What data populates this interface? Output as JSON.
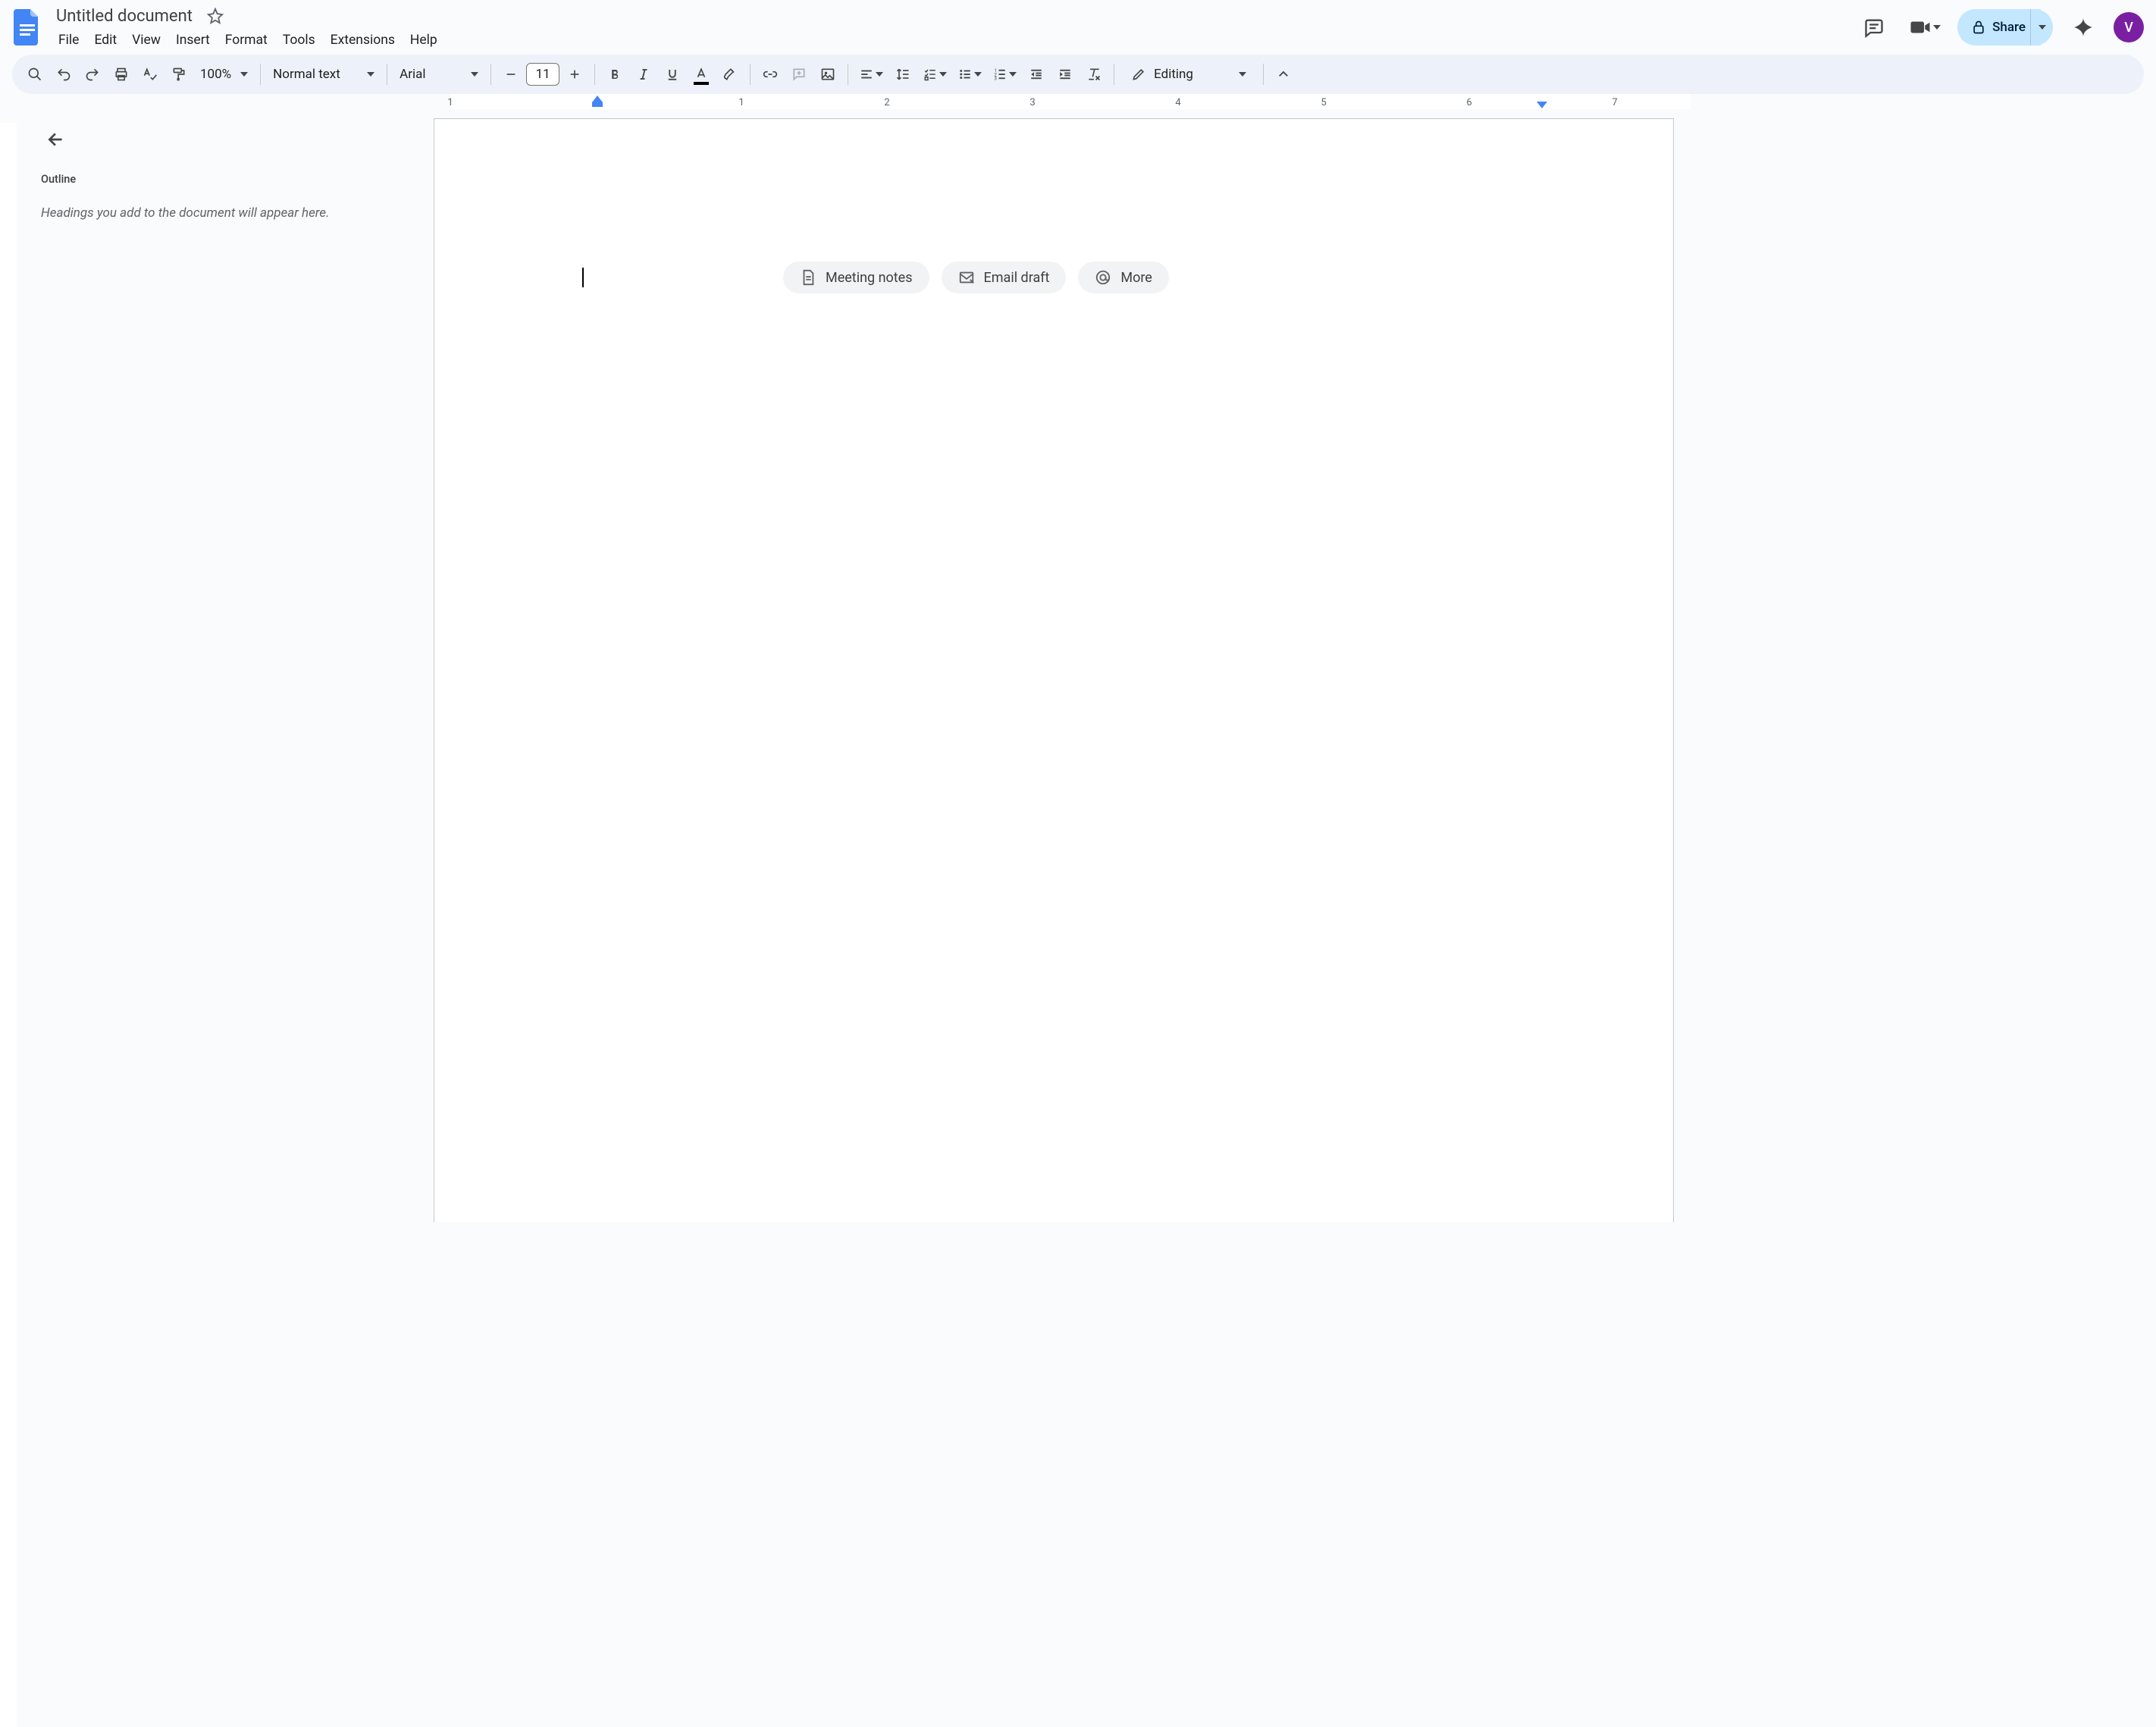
{
  "header": {
    "doc_title": "Untitled document",
    "menus": [
      "File",
      "Edit",
      "View",
      "Insert",
      "Format",
      "Tools",
      "Extensions",
      "Help"
    ],
    "share_label": "Share",
    "avatar_initial": "V"
  },
  "toolbar": {
    "zoom": "100%",
    "style": "Normal text",
    "font": "Arial",
    "font_size": "11",
    "mode": "Editing"
  },
  "ruler": {
    "numbers": [
      "1",
      "",
      "1",
      "2",
      "3",
      "4",
      "5",
      "6",
      "7"
    ]
  },
  "outline": {
    "title": "Outline",
    "empty_text": "Headings you add to the document will appear here."
  },
  "chips": {
    "meeting": "Meeting notes",
    "email": "Email draft",
    "more": "More"
  },
  "colors": {
    "share_bg": "#c2e7ff",
    "avatar_bg": "#7b1fa2",
    "toolbar_bg": "#edf2fa",
    "indent_marker": "#4285f4"
  }
}
